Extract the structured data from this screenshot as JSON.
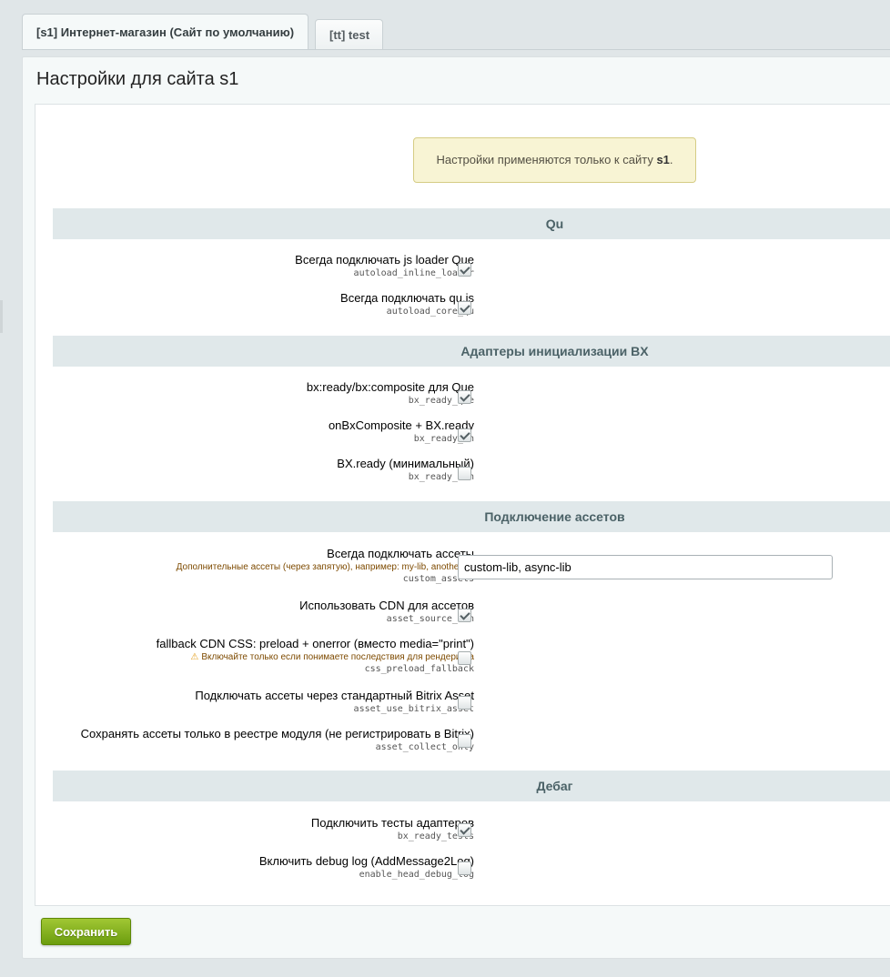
{
  "tabs": [
    {
      "label": "[s1] Интернет-магазин (Сайт по умолчанию)",
      "active": true
    },
    {
      "label": "[tt] test",
      "active": false
    }
  ],
  "page_title": "Настройки для сайта s1",
  "notice": {
    "prefix": "Настройки применяются только к сайту ",
    "site": "s1",
    "suffix": "."
  },
  "sections": {
    "qu": "Qu",
    "adapters": "Адаптеры инициализации BX",
    "assets": "Подключение ассетов",
    "debug": "Дебаг"
  },
  "options": {
    "autoload_inline_loader": {
      "label": "Всегда подключать js loader Que",
      "code": "autoload_inline_loader",
      "checked": true
    },
    "autoload_core_qu": {
      "label": "Всегда подключать qu.js",
      "code": "autoload_core_qu",
      "checked": true
    },
    "bx_ready_que": {
      "label": "bx:ready/bx:composite для Que",
      "code": "bx_ready_que",
      "checked": true
    },
    "bx_ready_on": {
      "label": "onBxComposite + BX.ready",
      "code": "bx_ready_on",
      "checked": true
    },
    "bx_ready_min": {
      "label": "BX.ready (минимальный)",
      "code": "bx_ready_min",
      "checked": false
    },
    "custom_assets": {
      "label": "Всегда подключать ассеты",
      "hint": "Дополнительные ассеты (через запятую), например: my-lib, another-lib",
      "code": "custom_assets",
      "value": "custom-lib, async-lib"
    },
    "asset_source_cdn": {
      "label": "Использовать CDN для ассетов",
      "code": "asset_source_cdn",
      "checked": true
    },
    "css_preload_fallback": {
      "label": "fallback CDN CSS: preload + onerror (вместо media=\"print\")",
      "warning": "Включайте только если понимаете последствия для рендеринга",
      "code": "css_preload_fallback",
      "checked": false
    },
    "asset_use_bitrix_asset": {
      "label": "Подключать ассеты через стандартный Bitrix Asset",
      "code": "asset_use_bitrix_asset",
      "checked": false
    },
    "asset_collect_only": {
      "label": "Сохранять ассеты только в реестре модуля (не регистрировать в Bitrix)",
      "code": "asset_collect_only",
      "checked": false
    },
    "bx_ready_tests": {
      "label": "Подключить тесты адаптеров",
      "code": "bx_ready_tests",
      "checked": true
    },
    "enable_head_debug_log": {
      "label": "Включить debug log (AddMessage2Log)",
      "code": "enable_head_debug_log",
      "checked": false
    }
  },
  "save_label": "Сохранить",
  "colors": {
    "accent": "#86b01f",
    "section_bg": "#e0e8ea",
    "notice_bg": "#f8f4d4"
  }
}
